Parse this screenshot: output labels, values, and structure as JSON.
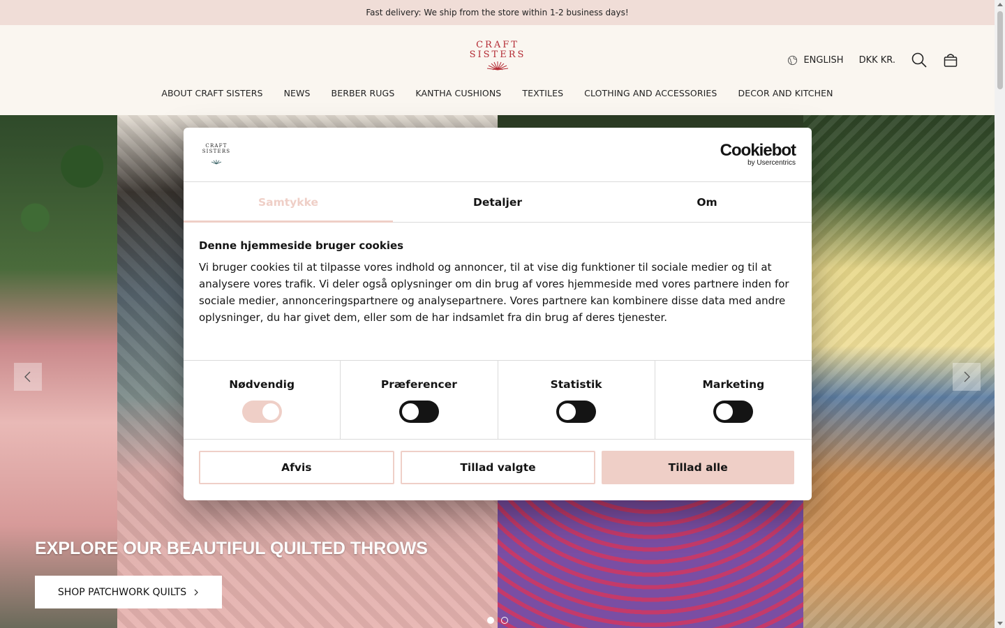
{
  "announcement": {
    "text": "Fast delivery: We ship from the store within 1-2 business days!"
  },
  "header": {
    "logo": {
      "line1": "CRAFT",
      "line2": "SISTERS"
    },
    "language": "ENGLISH",
    "currency": "DKK KR.",
    "nav": [
      {
        "label": "ABOUT CRAFT SISTERS"
      },
      {
        "label": "NEWS"
      },
      {
        "label": "BERBER RUGS"
      },
      {
        "label": "KANTHA CUSHIONS"
      },
      {
        "label": "TEXTILES"
      },
      {
        "label": "CLOTHING AND ACCESSORIES"
      },
      {
        "label": "DECOR AND KITCHEN"
      }
    ]
  },
  "hero": {
    "title": "EXPLORE OUR BEAUTIFUL QUILTED THROWS",
    "cta": "SHOP PATCHWORK QUILTS",
    "slides_total": 2,
    "active_slide": 1
  },
  "cookie": {
    "logo": {
      "line1": "CRAFT",
      "line2": "SISTERS"
    },
    "brand": {
      "name": "Cookiebot",
      "sub": "by Usercentrics"
    },
    "tabs": [
      {
        "label": "Samtykke",
        "active": true
      },
      {
        "label": "Detaljer",
        "active": false
      },
      {
        "label": "Om",
        "active": false
      }
    ],
    "heading": "Denne hjemmeside bruger cookies",
    "body": "Vi bruger cookies til at tilpasse vores indhold og annoncer, til at vise dig funktioner til sociale medier og til at analysere vores trafik. Vi deler også oplysninger om din brug af vores hjemmeside med vores partnere inden for sociale medier, annonceringspartnere og analysepartnere. Vores partnere kan kombinere disse data med andre oplysninger, du har givet dem, eller som de har indsamlet fra din brug af deres tjenester.",
    "toggles": [
      {
        "label": "Nødvendig",
        "on": true
      },
      {
        "label": "Præferencer",
        "on": false
      },
      {
        "label": "Statistik",
        "on": false
      },
      {
        "label": "Marketing",
        "on": false
      }
    ],
    "buttons": {
      "reject": "Afvis",
      "allow_selected": "Tillad valgte",
      "allow_all": "Tillad alle"
    }
  },
  "colors": {
    "accent": "#efcfc7",
    "brand_red": "#b32a33",
    "announce_bg": "#f0ddd7",
    "header_bg": "#faf6f0"
  }
}
